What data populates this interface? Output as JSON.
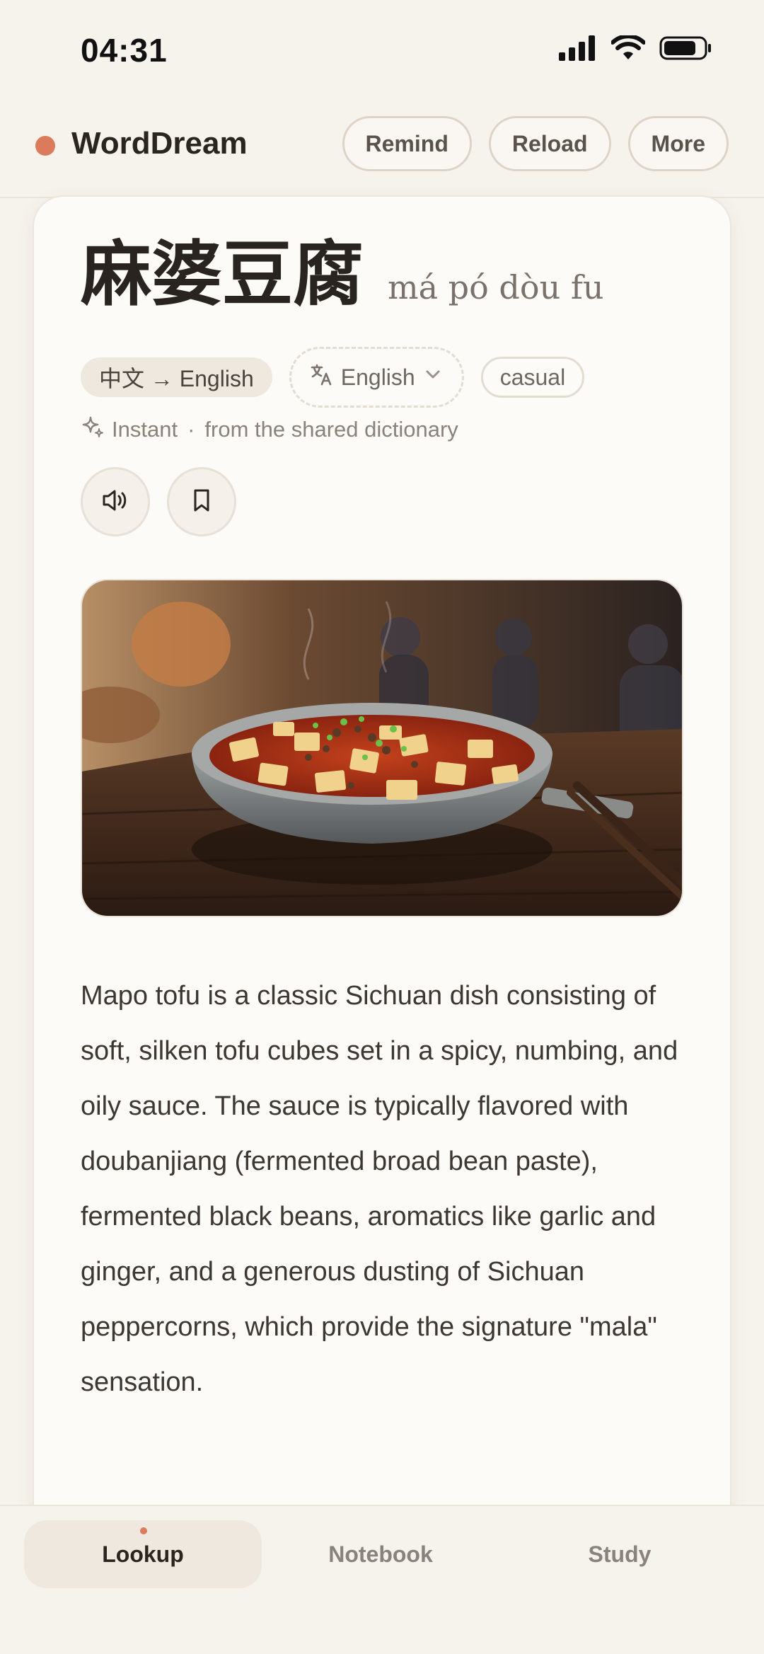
{
  "status_bar": {
    "time": "04:31"
  },
  "header": {
    "brand": "WordDream",
    "actions": [
      {
        "label": "Remind"
      },
      {
        "label": "Reload"
      },
      {
        "label": "More"
      }
    ]
  },
  "entry": {
    "word": "麻婆豆腐",
    "pinyin": "má pó dòu fu",
    "direction": "中文 → English",
    "target_language": "English",
    "register": "casual",
    "source_mode": "Instant",
    "source_separator": "·",
    "source_desc": "from the shared dictionary",
    "definition": "Mapo tofu is a classic Sichuan dish consisting of soft, silken tofu cubes set in a spicy, numbing, and oily sauce. The sauce is typically flavored with doubanjiang (fermented broad bean paste), fermented black beans, aromatics like garlic and ginger, and a generous dusting of Sichuan peppercorns, which provide the signature \"mala\" sensation."
  },
  "icons": {
    "speaker": "speaker-icon",
    "bookmark": "bookmark-icon",
    "translate": "translate-icon",
    "sparkle": "sparkle-icon",
    "chevron": "chevron-down-icon"
  },
  "nav": {
    "items": [
      {
        "label": "Lookup"
      },
      {
        "label": "Notebook"
      },
      {
        "label": "Study"
      }
    ]
  },
  "colors": {
    "accent": "#dc7a5c",
    "background": "#f6f2ec",
    "card": "#fcfbf8"
  }
}
